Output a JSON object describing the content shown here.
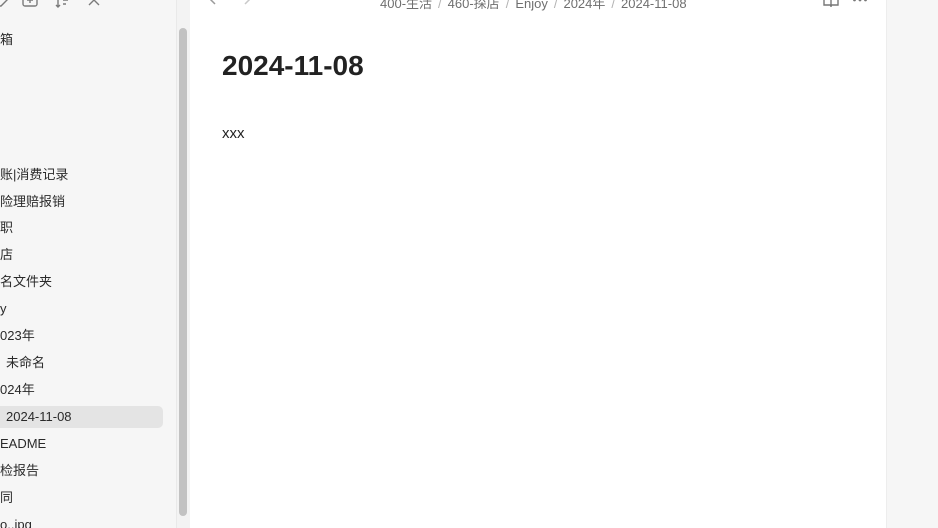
{
  "sidebar": {
    "toolbar_icons": [
      "new-note-icon",
      "new-folder-icon",
      "sort-icon",
      "collapse-icon"
    ],
    "items": [
      {
        "label": "箱"
      },
      {
        "label": "账|消费记录"
      },
      {
        "label": "险理赔报销"
      },
      {
        "label": "职"
      },
      {
        "label": "店"
      },
      {
        "label": "名文件夹"
      },
      {
        "label": "y"
      },
      {
        "label": "023年"
      },
      {
        "label": "未命名"
      },
      {
        "label": "024年"
      },
      {
        "label": "2024-11-08",
        "selected": true
      },
      {
        "label": "EADME"
      },
      {
        "label": "检报告"
      },
      {
        "label": "同"
      },
      {
        "label": "o..jpg"
      }
    ]
  },
  "header": {
    "breadcrumb": [
      "400-生活",
      "460-探店",
      "Enjoy",
      "2024年",
      "2024-11-08"
    ],
    "icons": [
      "back-arrow-icon",
      "forward-arrow-icon",
      "book-icon",
      "more-options-icon"
    ]
  },
  "document": {
    "title": "2024-11-08",
    "body": "xxx"
  },
  "colors": {
    "sidebar_bg": "#f6f6f6",
    "selected_bg": "#e4e4e4",
    "main_bg": "#ffffff"
  }
}
